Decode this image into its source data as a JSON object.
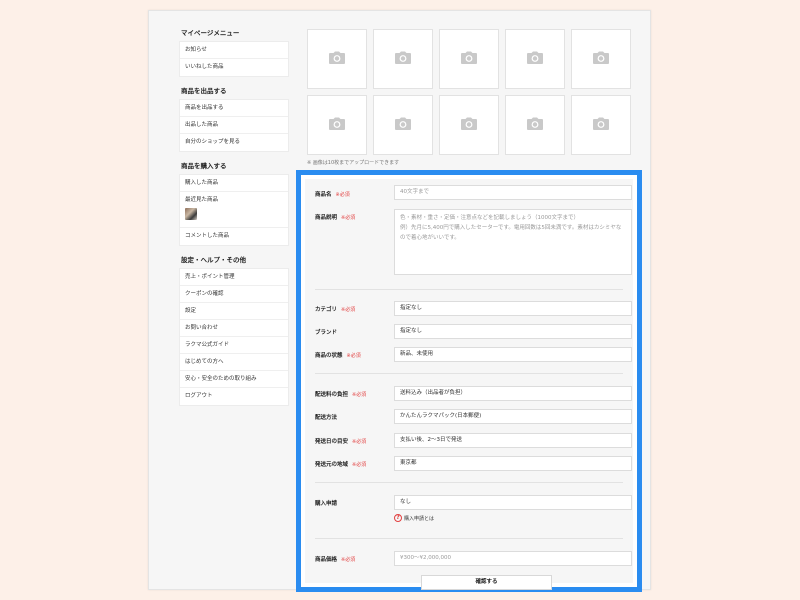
{
  "sidebar": {
    "sections": [
      {
        "title": "マイページメニュー",
        "items": [
          "お知らせ",
          "いいねした商品"
        ]
      },
      {
        "title": "商品を出品する",
        "items": [
          "商品を出品する",
          "出品した商品",
          "自分のショップを見る"
        ]
      },
      {
        "title": "商品を購入する",
        "items": [
          "購入した商品",
          "最近見た商品",
          "コメントした商品"
        ]
      },
      {
        "title": "設定・ヘルプ・その他",
        "items": [
          "売上・ポイント管理",
          "クーポンの確認",
          "設定",
          "お問い合わせ",
          "ラクマ公式ガイド",
          "はじめての方へ",
          "安心・安全のための取り組み",
          "ログアウト"
        ]
      }
    ]
  },
  "photos": {
    "count": 10,
    "icon": "camera-icon",
    "note": "※ 画像は10枚までアップロードできます"
  },
  "form": {
    "required_mark": "※必須",
    "name": {
      "label": "商品名",
      "placeholder": "40文字まで"
    },
    "description": {
      "label": "商品説明",
      "placeholder": "色・素材・重さ・定価・注意点などを記載しましょう（1000文字まで）\n例）先月に5,400円で購入したセーターです。電用回数は5回未満です。素材はカシミヤなので着心地がいいです。"
    },
    "category": {
      "label": "カテゴリ",
      "value": "指定なし"
    },
    "brand": {
      "label": "ブランド",
      "value": "指定なし"
    },
    "condition": {
      "label": "商品の状態",
      "value": "新品、未使用"
    },
    "shipping_fee": {
      "label": "配送料の負担",
      "value": "送料込み（出品者が負担）"
    },
    "shipping_method": {
      "label": "配送方法",
      "value": "かんたんラクマパック(日本郵便)"
    },
    "shipping_days": {
      "label": "発送日の目安",
      "value": "支払い後、2〜3日で発送"
    },
    "shipping_region": {
      "label": "発送元の地域",
      "value": "東京都"
    },
    "purchase_request": {
      "label": "購入申請",
      "value": "なし",
      "help": "購入申請とは"
    },
    "price": {
      "label": "商品価格",
      "placeholder": "¥300〜¥2,000,000"
    },
    "submit_label": "確認する"
  },
  "colors": {
    "highlight": "#2a8cf0",
    "required": "#e24040",
    "background": "#fdf0e8"
  }
}
